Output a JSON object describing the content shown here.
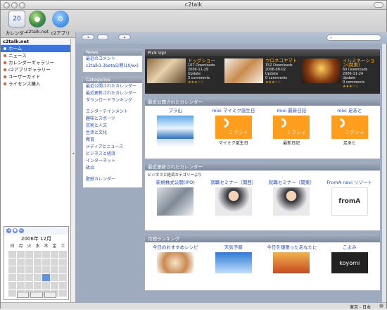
{
  "window": {
    "title": "c2talk"
  },
  "toolbar": {
    "items": [
      {
        "label": "カレンダー",
        "icon": "calendar-icon",
        "badge": "20"
      },
      {
        "label": "c2talk.net",
        "icon": "globe-icon"
      },
      {
        "label": "c2アプリ",
        "icon": "app-gear-icon"
      }
    ]
  },
  "sidebar": {
    "header": "c2talk.net",
    "items": [
      {
        "label": "ホーム",
        "selected": true
      },
      {
        "label": "ニュース"
      },
      {
        "label": "カレンダーギャラリー"
      },
      {
        "label": "c2アプリギャラリー"
      },
      {
        "label": "ユーザーガイド"
      },
      {
        "label": "ライセンス購入"
      }
    ]
  },
  "calendar": {
    "title": "2006年 12月",
    "weekdays": [
      "日",
      "月",
      "火",
      "水",
      "木",
      "金",
      "土"
    ],
    "today": 21
  },
  "nav": {
    "search_placeholder": ""
  },
  "news": {
    "header": "News",
    "links": [
      "最近のコメント",
      "c2talk1.3beta公開(10/xx)"
    ]
  },
  "categories": {
    "header": "Categories",
    "group1": [
      "最近公開されたカレンダー",
      "最近更新されたカレンダー",
      "ダウンロードランキング"
    ],
    "group2": [
      "エンターテインメント",
      "趣味とスポーツ",
      "芸術と人文",
      "生活と文化",
      "教育",
      "メディアとニュース",
      "ビジネスと経済",
      "インターネット",
      "政治"
    ],
    "group3": [
      "壁紙カレンダー"
    ]
  },
  "pickup": {
    "header": "Pick Up!",
    "items": [
      {
        "name": "ドッグショー",
        "downloads": "107 Downloads",
        "updated": "2006-11-29 Update",
        "comments": "3 comments",
        "stars": "★★★☆☆"
      },
      {
        "name": "ウロネコヤマト",
        "downloads": "152 Downloads",
        "updated": "2006-08-02 Update",
        "comments": "0 comments",
        "stars": "★★★☆☆"
      },
      {
        "name": "イルミネーション(関東)",
        "downloads": "60 Downloads",
        "updated": "2006-11-24 Update",
        "comments": "0 comments",
        "stars": "★★★☆☆"
      }
    ]
  },
  "recent_published": {
    "header": "最近公開されたカレンダー",
    "cards": [
      {
        "title": "ブラ山",
        "sub": ""
      },
      {
        "title": "mixi マイミク誕生日",
        "sub": "マイミク誕生日"
      },
      {
        "title": "mixi 最新日記",
        "sub": "最新日記"
      },
      {
        "title": "mixi 足あと",
        "sub": "足あと"
      }
    ]
  },
  "recent_updated": {
    "header": "最近更新されたカレンダー",
    "subtitle": "ビジネスと経済カテゴリーより",
    "cards": [
      {
        "title": "新規株式公開(IPO)"
      },
      {
        "title": "就職セミナー（関西）"
      },
      {
        "title": "就職セミナー（関東）"
      },
      {
        "title": "FromA navi リゾート"
      }
    ]
  },
  "ranking": {
    "header": "月間ランキング",
    "cards": [
      {
        "title": "今日のおすすめレシピ"
      },
      {
        "title": "天気予報"
      },
      {
        "title": "今日を頑張ったあなたに"
      },
      {
        "title": "こよみ"
      }
    ]
  },
  "status": {
    "zone": "東京 - 日本"
  }
}
